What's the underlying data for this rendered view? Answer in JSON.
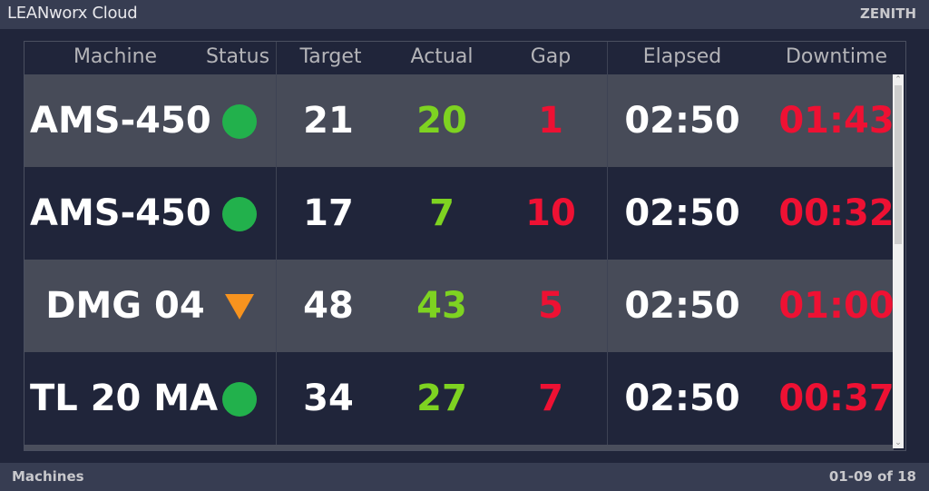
{
  "app": {
    "title": "LEANworx Cloud",
    "organization": "ZENITH"
  },
  "table": {
    "columns": [
      "Machine",
      "Status",
      "Target",
      "Actual",
      "Gap",
      "Elapsed",
      "Downtime"
    ],
    "rows": [
      {
        "machine": "AMS-450",
        "status": "running",
        "target": "21",
        "actual": "20",
        "gap": "1",
        "elapsed": "02:50",
        "downtime": "01:43"
      },
      {
        "machine": "AMS-450",
        "status": "running",
        "target": "17",
        "actual": "7",
        "gap": "10",
        "elapsed": "02:50",
        "downtime": "00:32"
      },
      {
        "machine": "DMG 04",
        "status": "down",
        "target": "48",
        "actual": "43",
        "gap": "5",
        "elapsed": "02:50",
        "downtime": "01:00"
      },
      {
        "machine": "TL 20 MA",
        "status": "running",
        "target": "34",
        "actual": "27",
        "gap": "7",
        "elapsed": "02:50",
        "downtime": "00:37"
      }
    ]
  },
  "footer": {
    "section": "Machines",
    "pagination": "01-09 of 18"
  },
  "colors": {
    "running": "#22b14c",
    "down": "#f7931e",
    "actual": "#7ed321",
    "negative": "#ee1133"
  }
}
